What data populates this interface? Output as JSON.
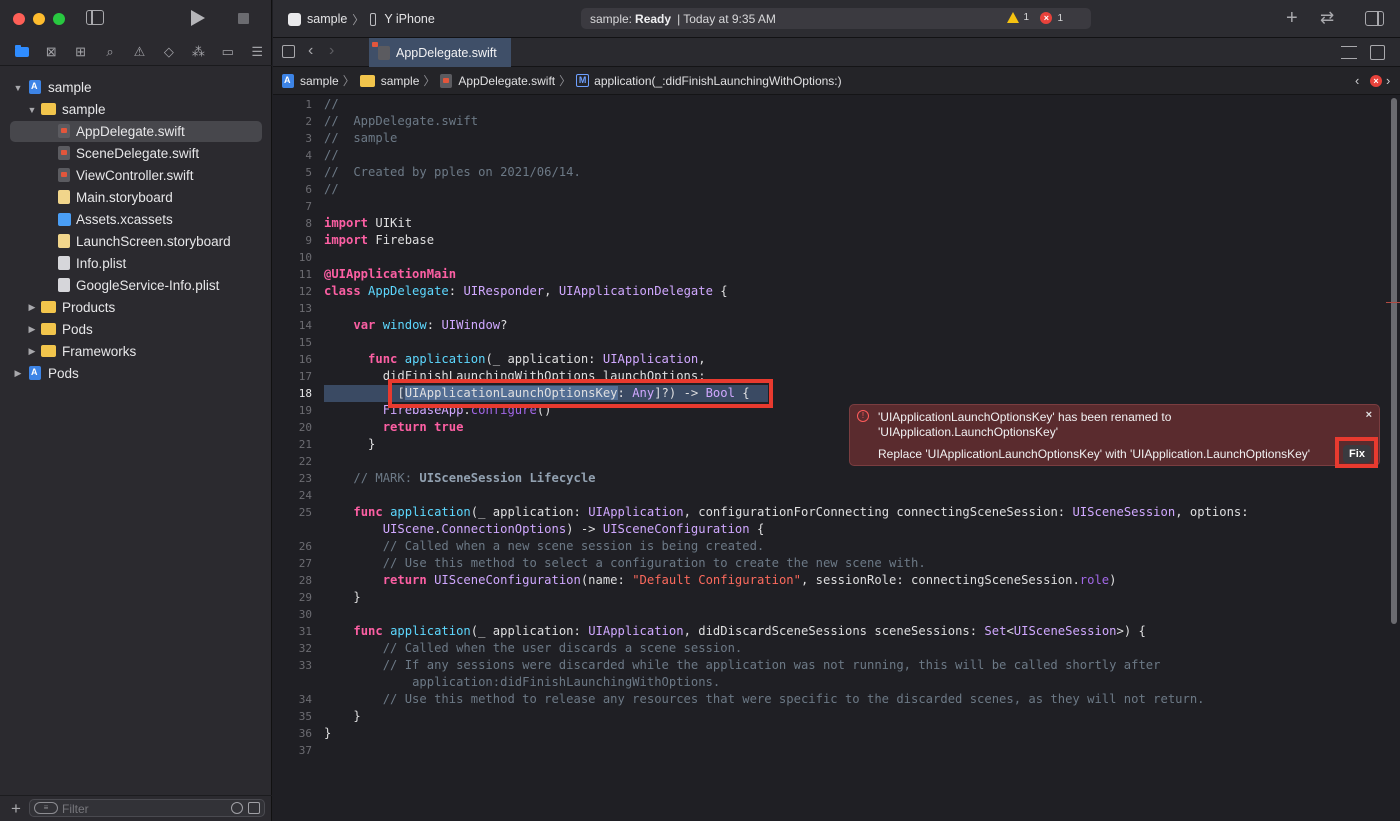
{
  "toolbar": {
    "scheme_name": "sample",
    "device_name": "Y iPhone",
    "status_project": "sample:",
    "status_state": "Ready",
    "status_time": "Today at 9:35 AM",
    "warnings_count": "1",
    "errors_count": "1"
  },
  "navigator": {
    "tree": [
      {
        "label": "sample",
        "icon": "project-icon",
        "disclosure": "open"
      },
      {
        "label": "sample",
        "icon": "folder-icon",
        "disclosure": "open"
      },
      {
        "label": "AppDelegate.swift",
        "icon": "swift-file-icon",
        "selected": true
      },
      {
        "label": "SceneDelegate.swift",
        "icon": "swift-file-icon"
      },
      {
        "label": "ViewController.swift",
        "icon": "swift-file-icon"
      },
      {
        "label": "Main.storyboard",
        "icon": "storyboard-file-icon"
      },
      {
        "label": "Assets.xcassets",
        "icon": "assets-icon"
      },
      {
        "label": "LaunchScreen.storyboard",
        "icon": "storyboard-file-icon"
      },
      {
        "label": "Info.plist",
        "icon": "plist-file-icon"
      },
      {
        "label": "GoogleService-Info.plist",
        "icon": "plist-file-icon"
      },
      {
        "label": "Products",
        "icon": "folder-icon",
        "disclosure": "closed"
      },
      {
        "label": "Pods",
        "icon": "folder-icon",
        "disclosure": "closed"
      },
      {
        "label": "Frameworks",
        "icon": "folder-icon",
        "disclosure": "closed"
      },
      {
        "label": "Pods",
        "icon": "project-icon",
        "disclosure": "closed"
      }
    ],
    "filter_placeholder": "Filter"
  },
  "editor": {
    "tab_label": "AppDelegate.swift",
    "jump_bar": [
      "sample",
      "sample",
      "AppDelegate.swift",
      "application(_:didFinishLaunchingWithOptions:)"
    ],
    "current_line": "18",
    "line_numbers": [
      "1",
      "2",
      "3",
      "4",
      "5",
      "6",
      "7",
      "8",
      "9",
      "10",
      "11",
      "12",
      "13",
      "14",
      "15",
      "16",
      "17",
      "18",
      "19",
      "20",
      "21",
      "22",
      "23",
      "24",
      "25",
      "",
      "26",
      "27",
      "28",
      "29",
      "30",
      "31",
      "32",
      "33",
      "",
      "34",
      "35",
      "36",
      "37"
    ]
  },
  "issue": {
    "message": "'UIApplicationLaunchOptionsKey' has been renamed to 'UIApplication.LaunchOptionsKey'",
    "fix_description": "Replace 'UIApplicationLaunchOptionsKey' with 'UIApplication.LaunchOptionsKey'",
    "fix_label": "Fix",
    "close_glyph": "×"
  },
  "colors": {
    "error_red": "#e8423b",
    "annotation_red": "#e83a2f",
    "keyword_pink": "#fc5fa3",
    "type_purple": "#d0a8ff",
    "comment_gray": "#6c7986",
    "string_red": "#fc6a5d",
    "selection_blue": "#3f4f68"
  }
}
